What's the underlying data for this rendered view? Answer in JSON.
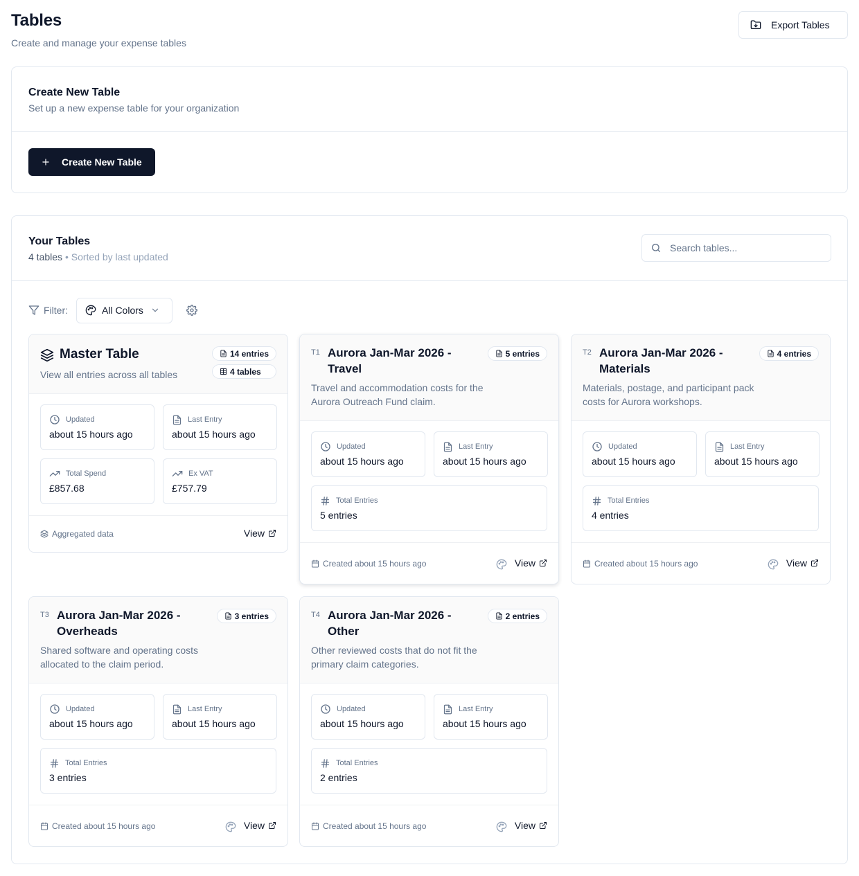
{
  "header": {
    "title": "Tables",
    "subtitle": "Create and manage your expense tables",
    "export_label": "Export Tables"
  },
  "create": {
    "title": "Create New Table",
    "subtitle": "Set up a new expense table for your organization",
    "button_label": "Create New Table"
  },
  "tables_section": {
    "title": "Your Tables",
    "count": "4 tables",
    "separator": "•",
    "sort": "Sorted by last updated",
    "search_placeholder": "Search tables...",
    "filter_label": "Filter:",
    "color_filter": "All Colors"
  },
  "master": {
    "title": "Master Table",
    "subtitle": "View all entries across all tables",
    "entries_badge": "14 entries",
    "tables_badge": "4 tables",
    "updated_label": "Updated",
    "updated": "about 15 hours ago",
    "last_entry_label": "Last Entry",
    "last_entry": "about 15 hours ago",
    "total_spend_label": "Total Spend",
    "total_spend": "£857.68",
    "ex_vat_label": "Ex VAT",
    "ex_vat": "£757.79",
    "footer": "Aggregated data",
    "view": "View"
  },
  "cards": [
    {
      "code": "T1",
      "name": "Aurora Jan-Mar 2026 - Travel",
      "description": "Travel and accommodation costs for the Aurora Outreach Fund claim.",
      "badge": "5 entries",
      "updated_label": "Updated",
      "updated": "about 15 hours ago",
      "last_entry_label": "Last Entry",
      "last_entry": "about 15 hours ago",
      "total_label": "Total Entries",
      "total": "5 entries",
      "created": "Created about 15 hours ago",
      "view": "View"
    },
    {
      "code": "T2",
      "name": "Aurora Jan-Mar 2026 - Materials",
      "description": "Materials, postage, and participant pack costs for Aurora workshops.",
      "badge": "4 entries",
      "updated_label": "Updated",
      "updated": "about 15 hours ago",
      "last_entry_label": "Last Entry",
      "last_entry": "about 15 hours ago",
      "total_label": "Total Entries",
      "total": "4 entries",
      "created": "Created about 15 hours ago",
      "view": "View"
    },
    {
      "code": "T3",
      "name": "Aurora Jan-Mar 2026 - Overheads",
      "description": "Shared software and operating costs allocated to the claim period.",
      "badge": "3 entries",
      "updated_label": "Updated",
      "updated": "about 15 hours ago",
      "last_entry_label": "Last Entry",
      "last_entry": "about 15 hours ago",
      "total_label": "Total Entries",
      "total": "3 entries",
      "created": "Created about 15 hours ago",
      "view": "View"
    },
    {
      "code": "T4",
      "name": "Aurora Jan-Mar 2026 - Other",
      "description": "Other reviewed costs that do not fit the primary claim categories.",
      "badge": "2 entries",
      "updated_label": "Updated",
      "updated": "about 15 hours ago",
      "last_entry_label": "Last Entry",
      "last_entry": "about 15 hours ago",
      "total_label": "Total Entries",
      "total": "2 entries",
      "created": "Created about 15 hours ago",
      "view": "View"
    }
  ],
  "colors": {
    "primary": "#0f172a",
    "muted": "#64748b",
    "border": "#e2e8f0",
    "card_head": "#fafafa"
  },
  "icons": {
    "export": "folder-export-icon",
    "plus": "plus-icon",
    "search": "search-icon",
    "filter": "filter-icon",
    "palette": "palette-icon",
    "chevron": "chevron-down-icon",
    "settings": "gear-icon",
    "layers": "layers-icon",
    "file": "file-text-icon",
    "grid": "table-grid-icon",
    "clock": "clock-icon",
    "trend": "trending-up-icon",
    "hash": "hash-icon",
    "calendar": "calendar-icon",
    "external": "external-link-icon"
  }
}
